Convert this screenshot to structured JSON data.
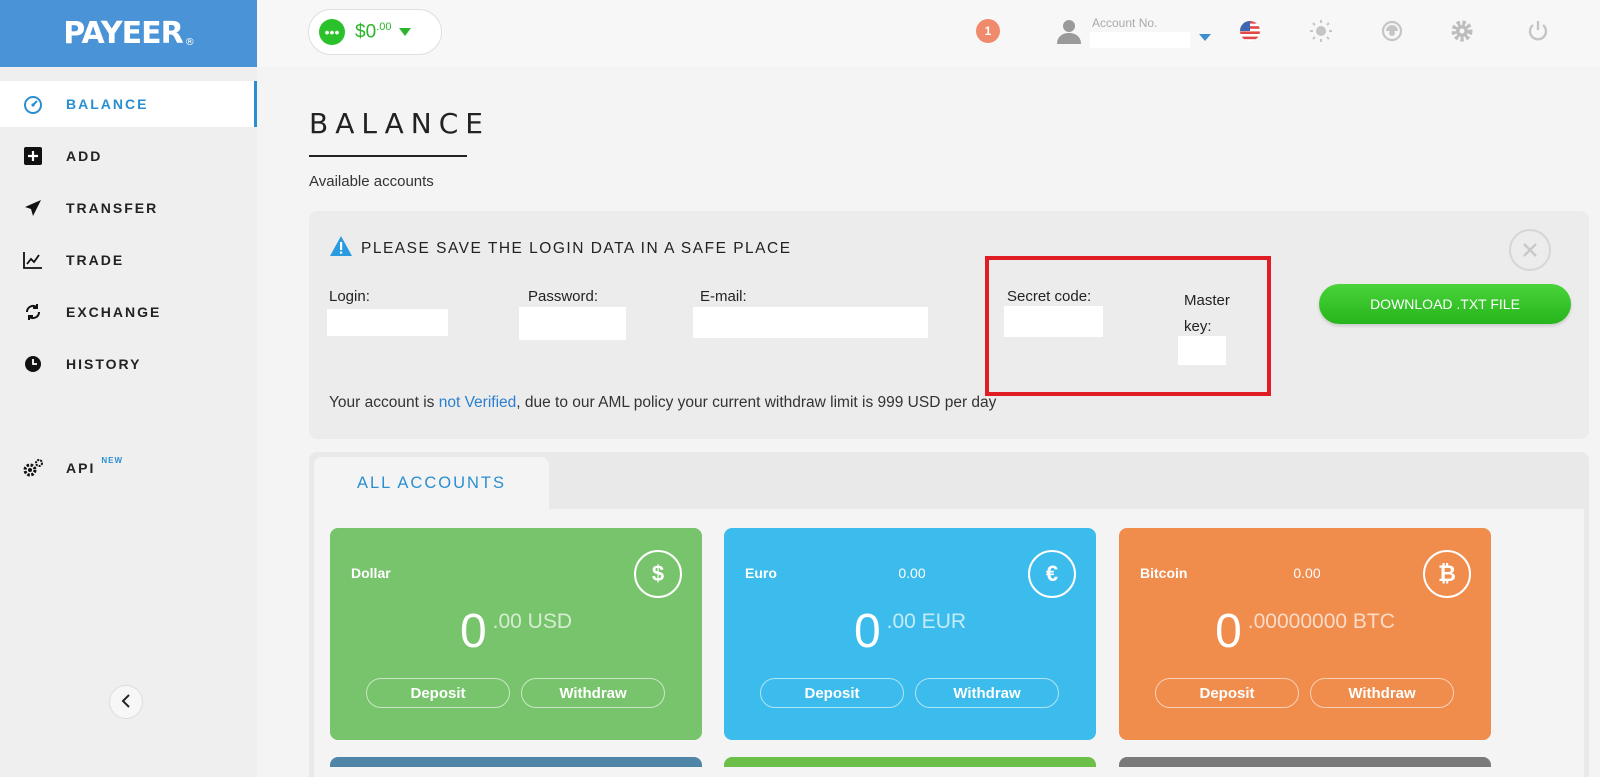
{
  "brand": {
    "name": "PAYEER",
    "mark": "®"
  },
  "header": {
    "balance_whole": "$0",
    "balance_cents": ".00",
    "notifications_count": "1",
    "account_label": "Account No."
  },
  "sidebar": {
    "items": [
      {
        "label": "BALANCE",
        "icon": "speedometer-icon"
      },
      {
        "label": "ADD",
        "icon": "plus-square-icon"
      },
      {
        "label": "TRANSFER",
        "icon": "paper-plane-icon"
      },
      {
        "label": "TRADE",
        "icon": "chart-line-icon"
      },
      {
        "label": "EXCHANGE",
        "icon": "refresh-icon"
      },
      {
        "label": "HISTORY",
        "icon": "clock-icon"
      }
    ],
    "api_label": "API",
    "api_badge": "NEW"
  },
  "page": {
    "title": "BALANCE",
    "subtitle": "Available accounts"
  },
  "notice": {
    "title": "PLEASE SAVE THE LOGIN DATA IN A SAFE PLACE",
    "login_label": "Login:",
    "password_label": "Password:",
    "email_label": "E-mail:",
    "secret_label": "Secret code:",
    "master_label_1": "Master",
    "master_label_2": "key:",
    "download_label": "DOWNLOAD .TXT FILE",
    "verify_prefix": "Your account is ",
    "verify_link": "not Verified",
    "verify_suffix": ", due to our AML policy your current withdraw limit is 999 USD per day"
  },
  "accounts": {
    "tab_label": "ALL ACCOUNTS",
    "cards": [
      {
        "name": "Dollar",
        "small_value": "",
        "symbol": "$",
        "int": "0",
        "frac": ".00 USD",
        "deposit": "Deposit",
        "withdraw": "Withdraw",
        "color": "#78c46c"
      },
      {
        "name": "Euro",
        "small_value": "0.00",
        "symbol": "€",
        "int": "0",
        "frac": ".00 EUR",
        "deposit": "Deposit",
        "withdraw": "Withdraw",
        "color": "#3cbcec"
      },
      {
        "name": "Bitcoin",
        "small_value": "0.00",
        "symbol": "₿",
        "int": "0",
        "frac": ".00000000 BTC",
        "deposit": "Deposit",
        "withdraw": "Withdraw",
        "color": "#f08c4c"
      }
    ]
  },
  "colors": {
    "brand": "#4a93d6",
    "accent": "#2a8fd0",
    "green": "#2bc12b",
    "highlight": "#e01d24"
  }
}
